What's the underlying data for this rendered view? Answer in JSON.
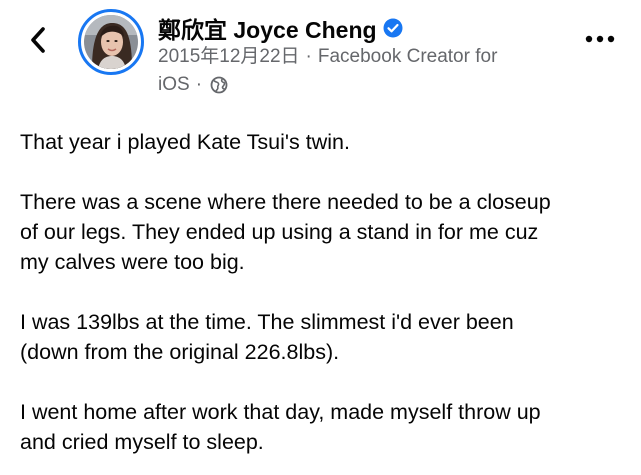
{
  "header": {
    "name": "鄭欣宜 Joyce Cheng",
    "date": "2015年12月22日",
    "separator": "·",
    "source_line1": "Facebook Creator for",
    "source_line2": "iOS",
    "icons": {
      "back": "back-chevron-icon",
      "verified": "verified-badge-icon",
      "privacy": "globe-icon",
      "more": "more-dots-icon"
    },
    "colors": {
      "verified_blue": "#1877f2",
      "meta_gray": "#65676b",
      "text": "#050505"
    }
  },
  "post": {
    "paragraphs": [
      {
        "lines": [
          "That year i played Kate Tsui's twin."
        ]
      },
      {
        "lines": [
          "There was a scene where there needed to be a closeup",
          "of our legs. They ended up using a stand in for me cuz",
          "my calves were too big."
        ]
      },
      {
        "lines": [
          "I was 139lbs at the time. The slimmest i'd ever been",
          "(down from the original 226.8lbs)."
        ]
      },
      {
        "lines": [
          "I went home after work that day, made myself throw up",
          "and cried myself to sleep."
        ]
      }
    ]
  }
}
